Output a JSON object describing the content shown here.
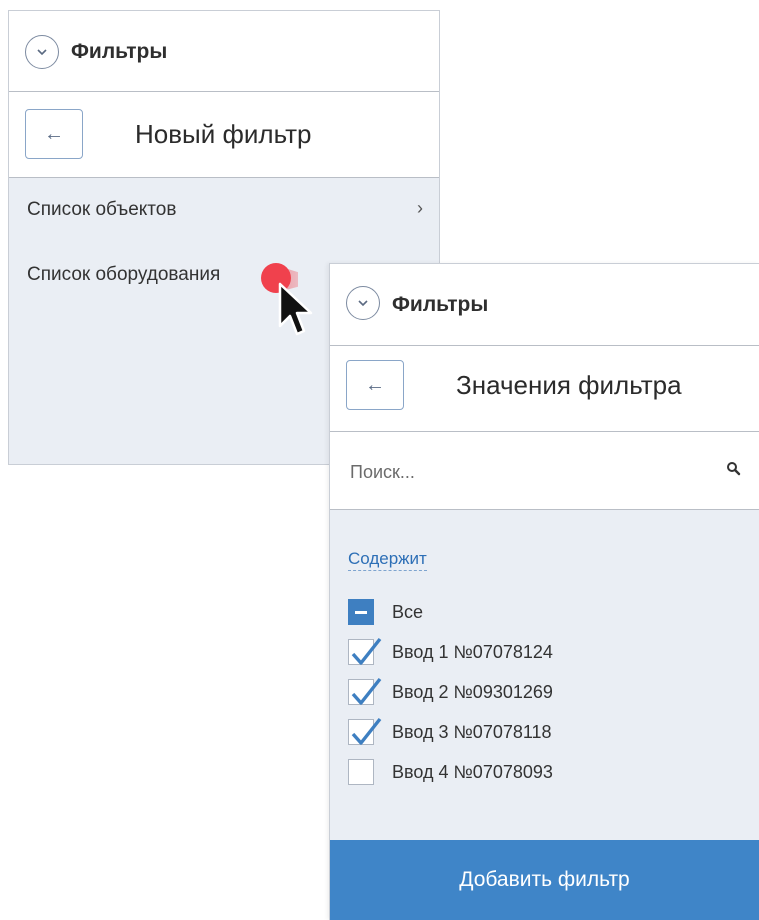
{
  "panel1": {
    "header_title": "Фильтры",
    "subheader_title": "Новый фильтр",
    "back_label": "←",
    "items": [
      {
        "label": "Список объектов",
        "chevron": "›"
      },
      {
        "label": "Список оборудования"
      }
    ]
  },
  "panel2": {
    "header_title": "Фильтры",
    "subheader_title": "Значения фильтра",
    "back_label": "←",
    "search": {
      "placeholder": "Поиск...",
      "value": ""
    },
    "contains_label": "Содержит",
    "options": [
      {
        "label": "Все",
        "state": "indeterminate"
      },
      {
        "label": "Ввод 1 №07078124",
        "state": "checked"
      },
      {
        "label": "Ввод 2 №09301269",
        "state": "checked"
      },
      {
        "label": "Ввод 3 №07078118",
        "state": "checked"
      },
      {
        "label": "Ввод 4 №07078093",
        "state": "unchecked"
      }
    ],
    "add_button_label": "Добавить фильтр"
  },
  "icons": {
    "collapse": "chevron-down-circle-icon",
    "back": "arrow-left-icon",
    "search": "search-icon",
    "cursor": "mouse-pointer-icon"
  },
  "colors": {
    "accent": "#3f85c8",
    "panel_bg": "#eaeef4",
    "checkmark": "#3e7fc1",
    "link": "#2d6fb6",
    "click_indicator": "#f0414d"
  }
}
